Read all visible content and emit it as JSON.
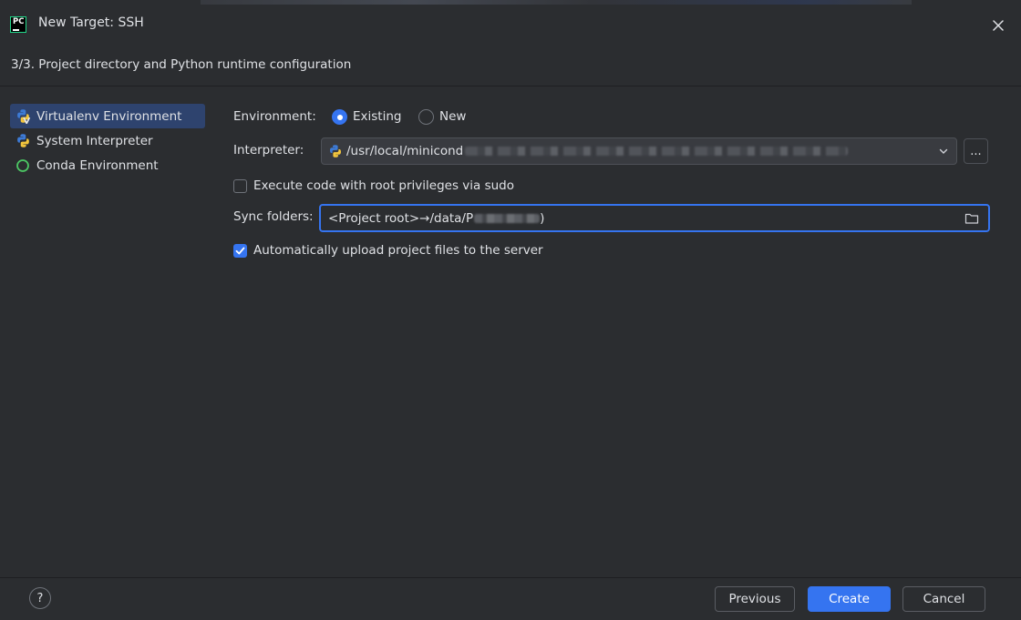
{
  "window": {
    "app_logo_text": "PC",
    "title": "New Target: SSH",
    "step_title": "3/3. Project directory and Python runtime configuration"
  },
  "sidebar": {
    "items": [
      {
        "label": "Virtualenv Environment",
        "icon": "virtualenv-icon",
        "selected": true
      },
      {
        "label": "System Interpreter",
        "icon": "python-icon",
        "selected": false
      },
      {
        "label": "Conda Environment",
        "icon": "conda-icon",
        "selected": false
      }
    ]
  },
  "form": {
    "environment_label": "Environment:",
    "option_existing": "Existing",
    "option_new": "New",
    "selected_option": "Existing",
    "interpreter_label": "Interpreter:",
    "interpreter_value": "/usr/local/minicond",
    "browse_label": "...",
    "sudo_label": "Execute code with root privileges via sudo",
    "sudo_checked": false,
    "sync_label": "Sync folders:",
    "sync_value": "<Project root>→/data/P",
    "sync_value_end": ")",
    "upload_label": "Automatically upload project files to the server",
    "upload_checked": true
  },
  "footer": {
    "help_label": "?",
    "previous_label": "Previous",
    "create_label": "Create",
    "cancel_label": "Cancel"
  },
  "colors": {
    "background": "#2b2d30",
    "accent": "#3574f0",
    "selection": "#2e436e",
    "text": "#dfe1e5",
    "border": "#4e5157"
  }
}
